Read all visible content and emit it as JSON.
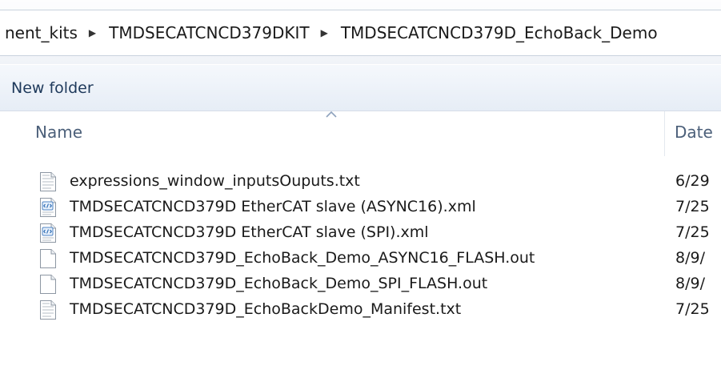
{
  "address": {
    "crumbs": [
      "nent_kits",
      "TMDSECATCNCD379DKIT",
      "TMDSECATCNCD379D_EchoBack_Demo"
    ],
    "separator": "▶"
  },
  "toolbar": {
    "new_folder_label": "New folder"
  },
  "columns": {
    "name_label": "Name",
    "date_label": "Date"
  },
  "files": [
    {
      "name": "expressions_window_inputsOuputs.txt",
      "date": "6/29",
      "icon": "text-file-icon"
    },
    {
      "name": "TMDSECATCNCD379D EtherCAT slave (ASYNC16).xml",
      "date": "7/25",
      "icon": "xml-file-icon"
    },
    {
      "name": "TMDSECATCNCD379D EtherCAT slave (SPI).xml",
      "date": "7/25",
      "icon": "xml-file-icon"
    },
    {
      "name": "TMDSECATCNCD379D_EchoBack_Demo_ASYNC16_FLASH.out",
      "date": "8/9/",
      "icon": "blank-file-icon"
    },
    {
      "name": "TMDSECATCNCD379D_EchoBack_Demo_SPI_FLASH.out",
      "date": "8/9/",
      "icon": "blank-file-icon"
    },
    {
      "name": "TMDSECATCNCD379D_EchoBackDemo_Manifest.txt",
      "date": "7/25",
      "icon": "text-file-icon"
    }
  ]
}
